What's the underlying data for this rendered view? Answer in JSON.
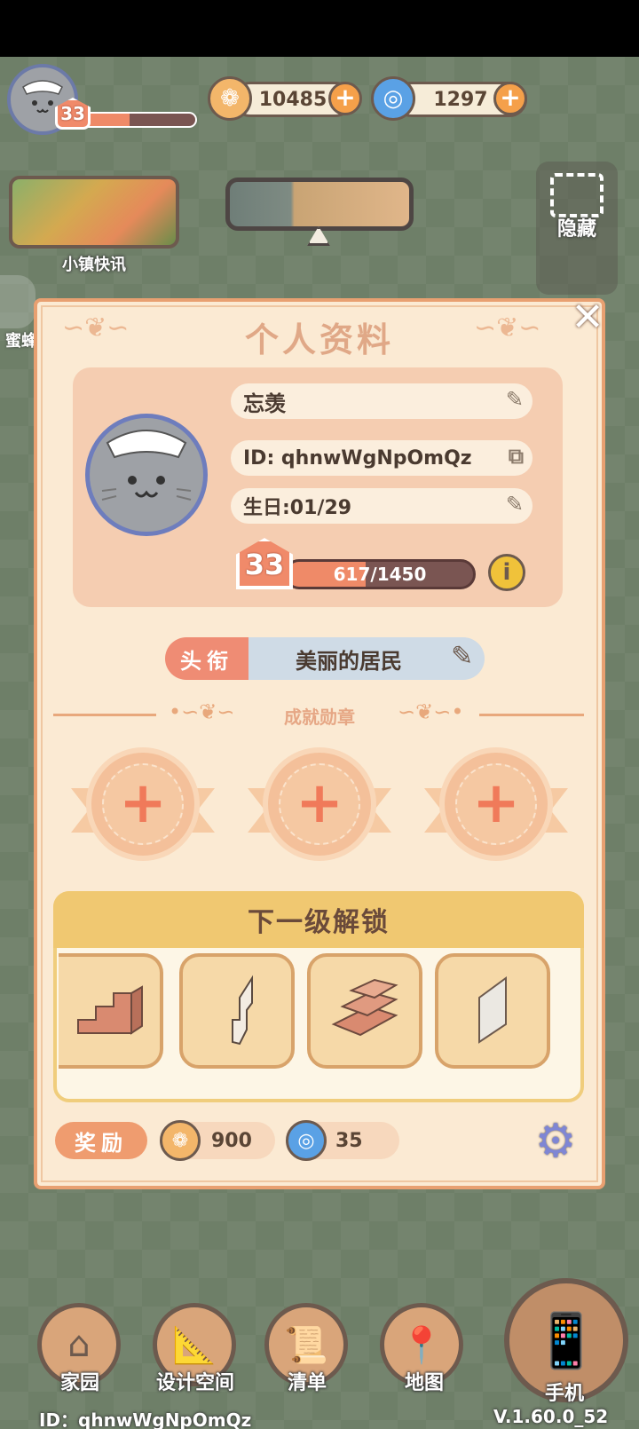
{
  "hud": {
    "level": "33",
    "level_progress": 0.42,
    "coins": "10485",
    "gems": "1297",
    "plus_symbol": "+",
    "news_label": "小镇快讯",
    "hide_label": "隐藏",
    "left_tab_label": "蜜蜂"
  },
  "panel": {
    "title": "个人资料",
    "close_symbol": "✕",
    "name": "忘羡",
    "id_text": "ID: qhnwWgNpOmQz",
    "birthday": "生日:01/29",
    "level": "33",
    "exp_text": "617/1450",
    "exp_progress": 0.4255,
    "info_symbol": "i",
    "title_tag_label": "头衔",
    "title_tag_value": "美丽的居民",
    "achievements_label": "成就勋章",
    "medal_plus": "+",
    "unlock_header": "下一级解锁",
    "reward_label": "奖励",
    "reward_coins": "900",
    "reward_gems": "35"
  },
  "nav": {
    "home": "家园",
    "design": "设计空间",
    "list": "清单",
    "map": "地图",
    "phone": "手机"
  },
  "footer": {
    "id": "ID：qhnwWgNpOmQz",
    "version": "V.1.60.0_52"
  },
  "colors": {
    "accent": "#ef8a68",
    "panel_bg": "#fbead3",
    "card_bg": "#f5cdb1",
    "title_color": "#e0a887"
  }
}
